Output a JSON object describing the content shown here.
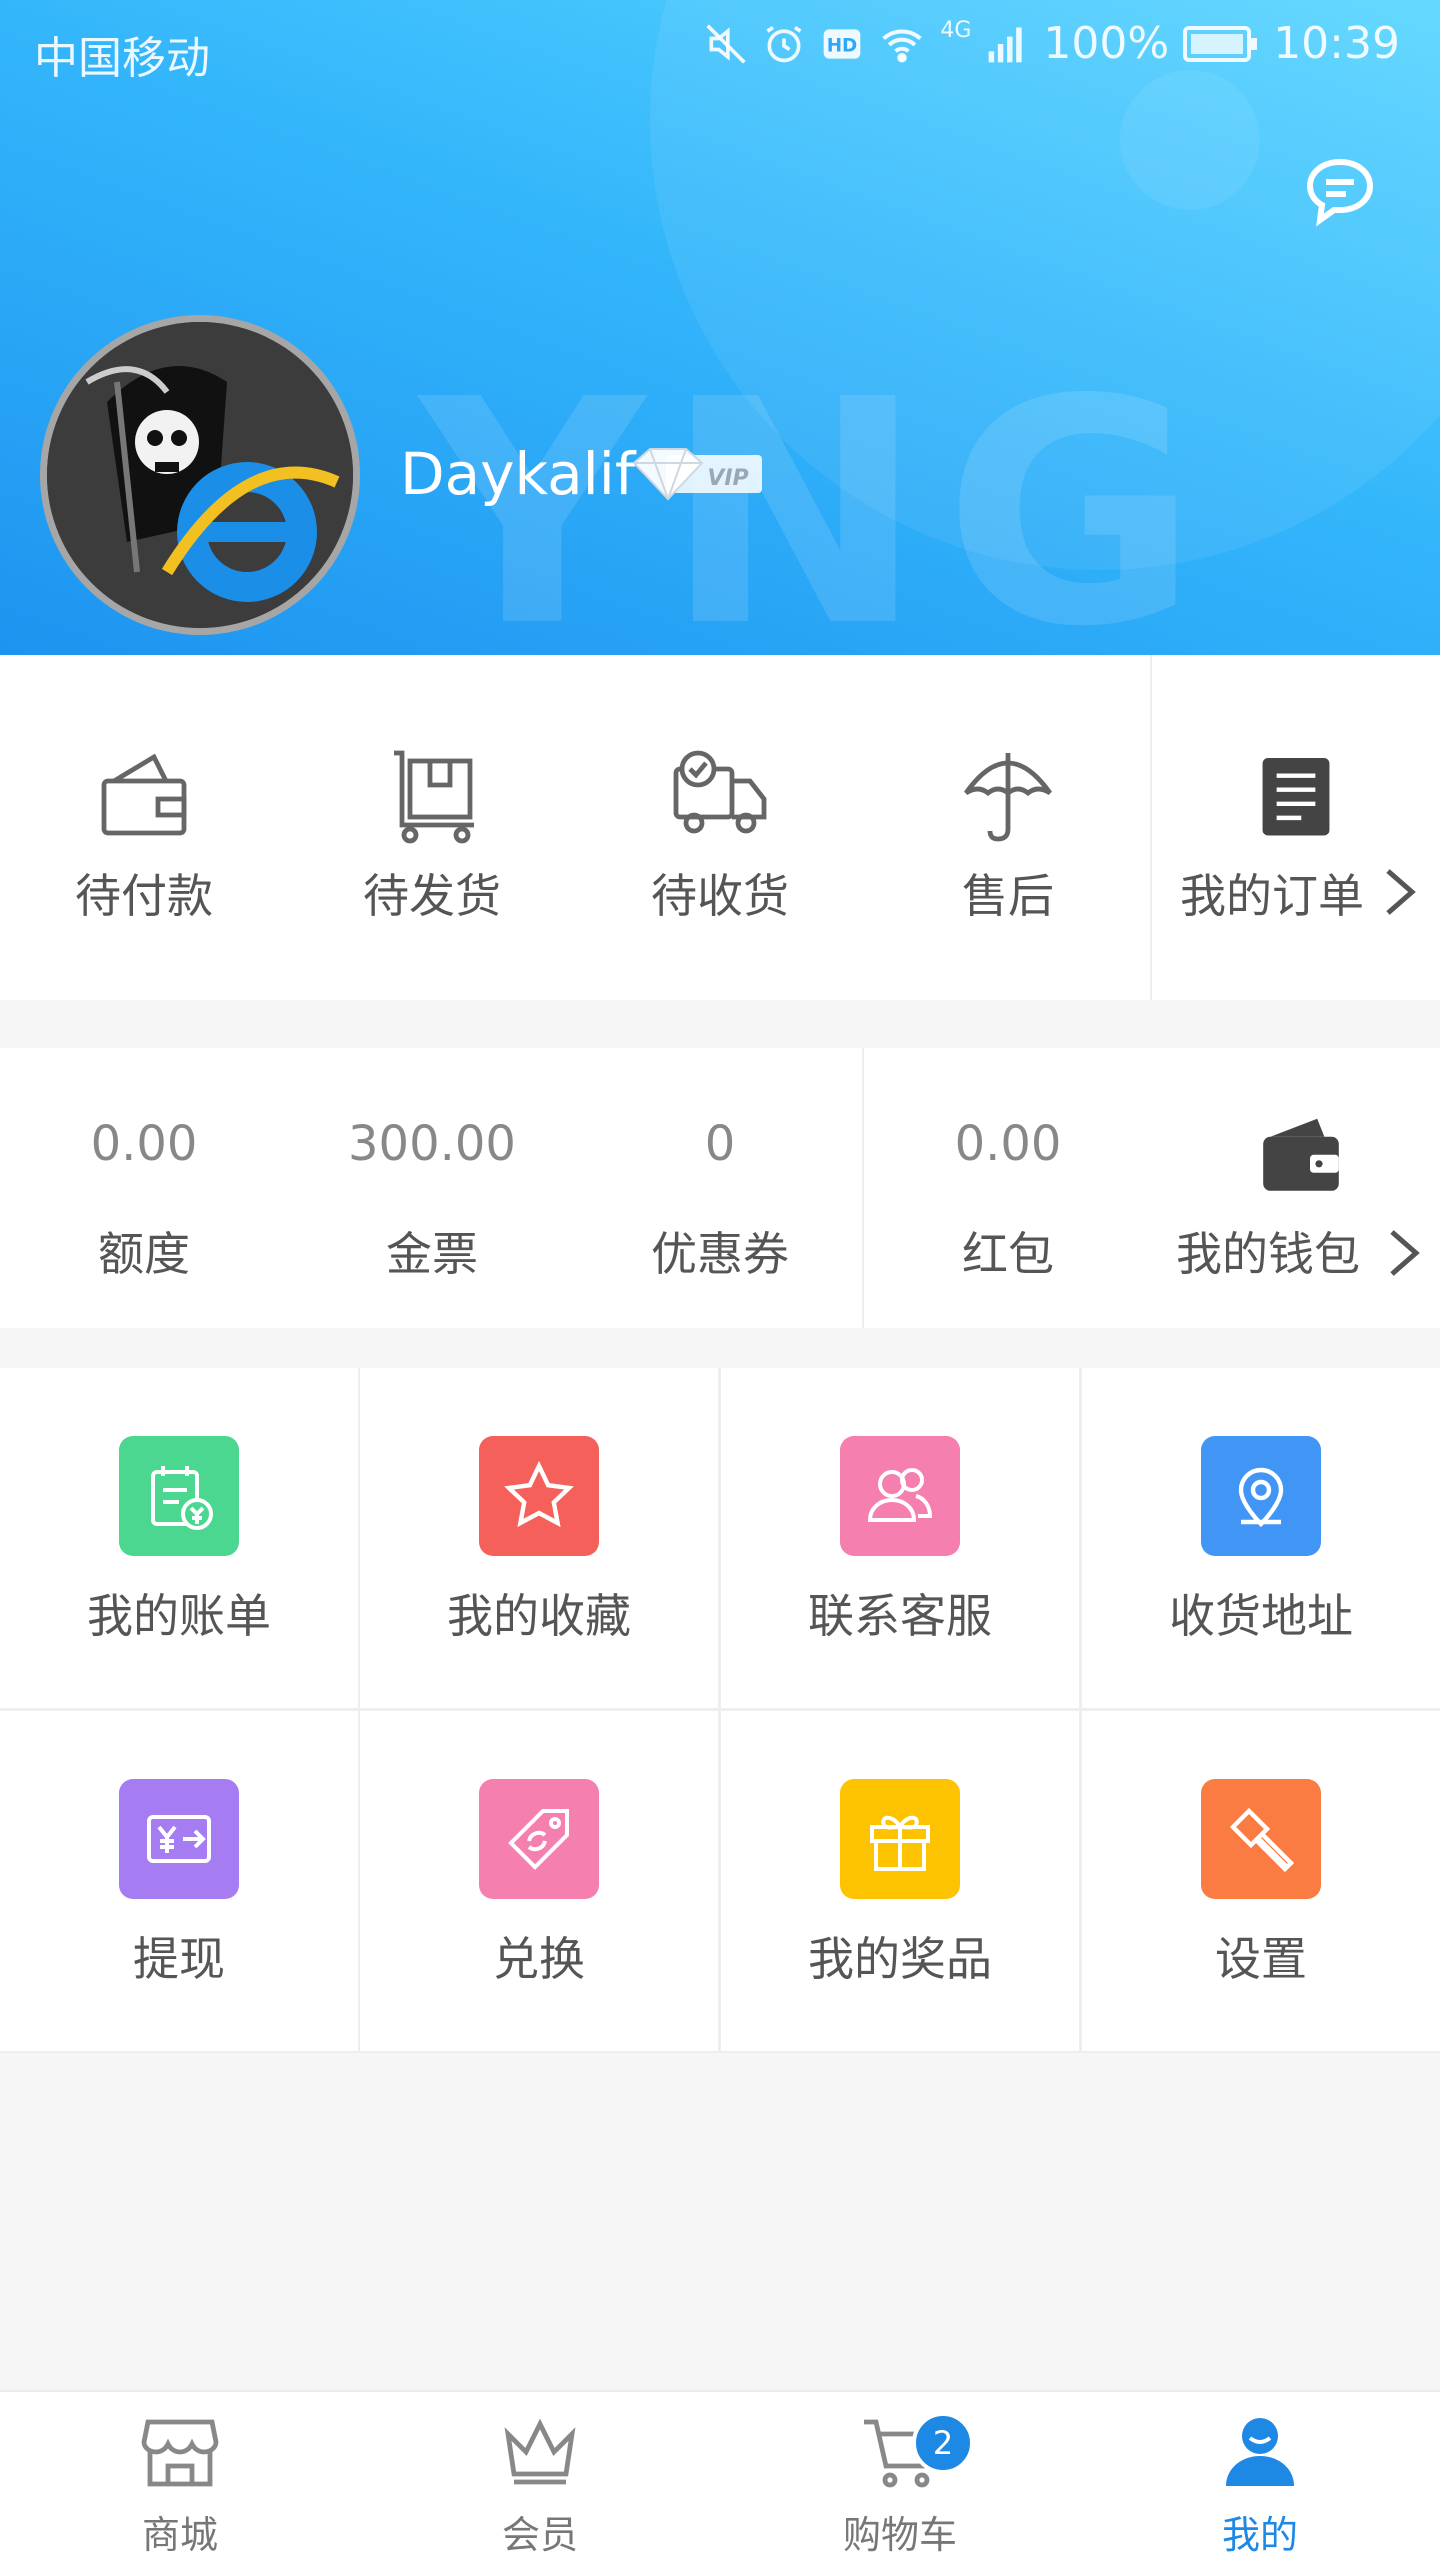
{
  "status_bar": {
    "carrier": "中国移动",
    "network": "4G",
    "battery": "100%",
    "time": "10:39"
  },
  "header": {
    "watermark": "YNG",
    "username": "Daykalif",
    "badge_text": "VIP",
    "chat_icon": "chat-bubble-icon"
  },
  "orders": {
    "items": [
      {
        "label": "待付款",
        "icon": "wallet-icon"
      },
      {
        "label": "待发货",
        "icon": "package-cart-icon"
      },
      {
        "label": "待收货",
        "icon": "delivery-truck-icon"
      },
      {
        "label": "售后",
        "icon": "umbrella-icon"
      }
    ],
    "more_label": "我的订单"
  },
  "wallet": {
    "items": [
      {
        "value": "0.00",
        "label": "额度"
      },
      {
        "value": "300.00",
        "label": "金票"
      },
      {
        "value": "0",
        "label": "优惠券"
      },
      {
        "value": "0.00",
        "label": "红包"
      }
    ],
    "more_label": "我的钱包"
  },
  "grid": {
    "items": [
      {
        "label": "我的账单",
        "icon": "bill-icon",
        "color": "#4cd790"
      },
      {
        "label": "我的收藏",
        "icon": "star-icon",
        "color": "#f5605a"
      },
      {
        "label": "联系客服",
        "icon": "people-icon",
        "color": "#f57fae"
      },
      {
        "label": "收货地址",
        "icon": "location-icon",
        "color": "#4095f5"
      },
      {
        "label": "提现",
        "icon": "withdraw-icon",
        "color": "#a57cf2"
      },
      {
        "label": "兑换",
        "icon": "tag-icon",
        "color": "#f57fae"
      },
      {
        "label": "我的奖品",
        "icon": "gift-icon",
        "color": "#fdc300"
      },
      {
        "label": "设置",
        "icon": "hammer-icon",
        "color": "#fb7c43"
      }
    ]
  },
  "tabbar": {
    "items": [
      {
        "label": "商城",
        "icon": "store-icon"
      },
      {
        "label": "会员",
        "icon": "crown-icon"
      },
      {
        "label": "购物车",
        "icon": "cart-icon",
        "badge": "2"
      },
      {
        "label": "我的",
        "icon": "user-icon",
        "active": true
      }
    ]
  },
  "colors": {
    "header_gradient_start": "#5ad6ff",
    "header_gradient_end": "#1d94f0",
    "accent": "#1e88e5",
    "text": "#555555"
  }
}
